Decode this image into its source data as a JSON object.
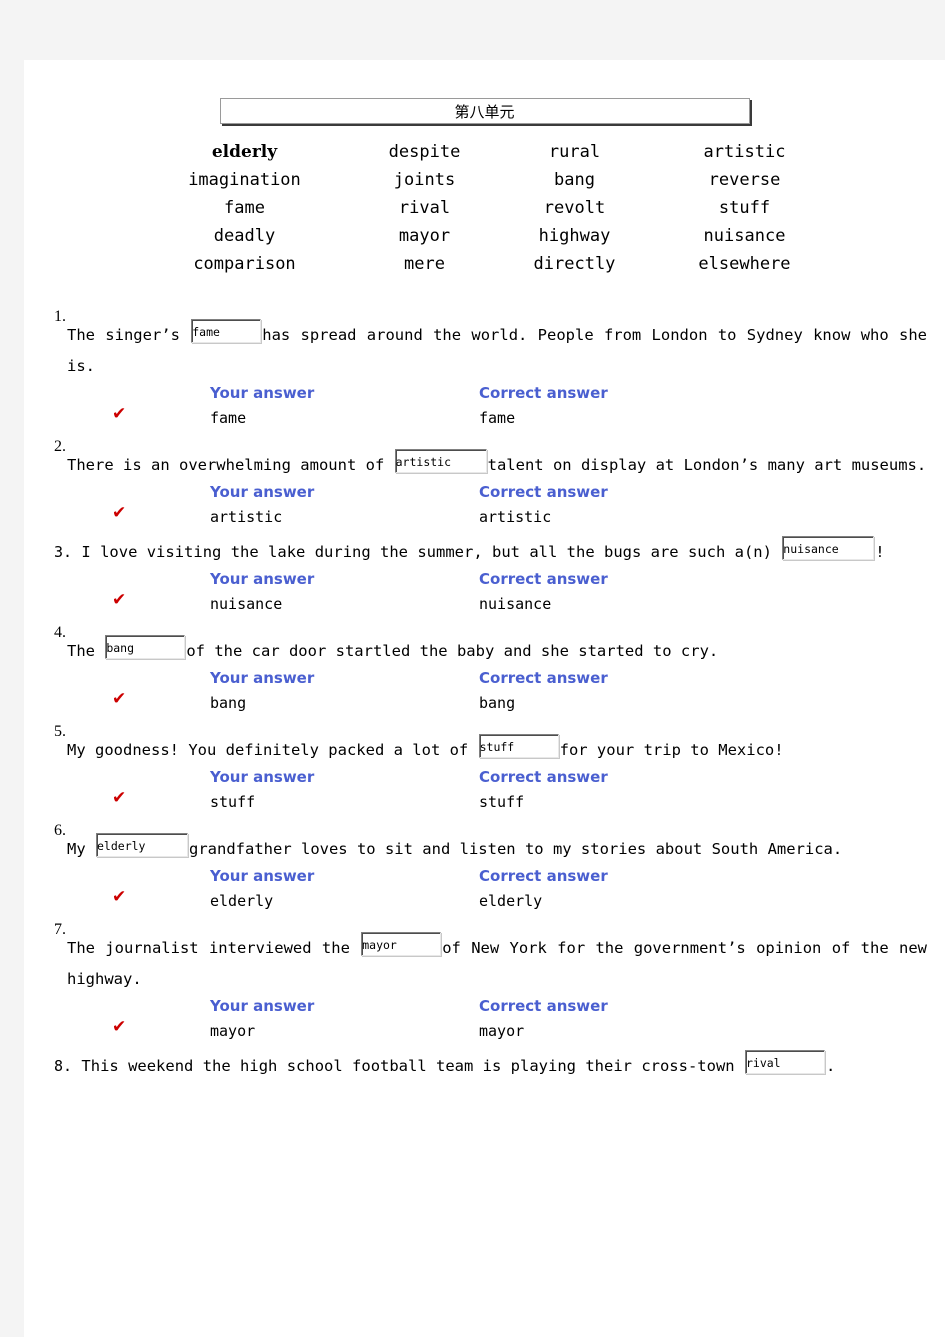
{
  "document": {
    "title": "第八单元",
    "accent_blue": "#4a5fd0",
    "check_red": "#cc0000",
    "check_glyph": "✔"
  },
  "word_bank": {
    "rows": [
      [
        {
          "word": "elderly",
          "bold": true
        },
        {
          "word": "despite",
          "bold": false
        },
        {
          "word": "rural",
          "bold": false
        },
        {
          "word": "artistic",
          "bold": false
        }
      ],
      [
        {
          "word": "imagination",
          "bold": false
        },
        {
          "word": "joints",
          "bold": false
        },
        {
          "word": "bang",
          "bold": false
        },
        {
          "word": "reverse",
          "bold": false
        }
      ],
      [
        {
          "word": "fame",
          "bold": false
        },
        {
          "word": "rival",
          "bold": false
        },
        {
          "word": "revolt",
          "bold": false
        },
        {
          "word": "stuff",
          "bold": false
        }
      ],
      [
        {
          "word": "deadly",
          "bold": false
        },
        {
          "word": "mayor",
          "bold": false
        },
        {
          "word": "highway",
          "bold": false
        },
        {
          "word": "nuisance",
          "bold": false
        }
      ],
      [
        {
          "word": "comparison",
          "bold": false
        },
        {
          "word": "mere",
          "bold": false
        },
        {
          "word": "directly",
          "bold": false
        },
        {
          "word": "elsewhere",
          "bold": false
        }
      ]
    ]
  },
  "answer_labels": {
    "your_answer": "Your answer",
    "correct_answer": "Correct answer"
  },
  "questions": [
    {
      "number": "1.",
      "layout": "number-above",
      "before": "The singer’s ",
      "blank_value": "fame",
      "blank_width": "w-sm",
      "after": "has spread around the world. People from London to Sydney know who she is.",
      "your_answer": "fame",
      "correct_answer": "fame",
      "is_correct": true
    },
    {
      "number": "2.",
      "layout": "number-above",
      "before": "There is an overwhelming amount of ",
      "blank_value": "artistic",
      "blank_width": "w-lg",
      "after": "talent on display at London’s many art museums.",
      "your_answer": "artistic",
      "correct_answer": "artistic",
      "is_correct": true
    },
    {
      "number": "3.",
      "layout": "number-inline",
      "before": "I love visiting the lake during the summer, but all the bugs are such a(n) ",
      "blank_value": "nuisance",
      "blank_width": "w-lg",
      "after": "!",
      "your_answer": "nuisance",
      "correct_answer": "nuisance",
      "is_correct": true
    },
    {
      "number": "4.",
      "layout": "number-above",
      "before": "The ",
      "blank_value": "bang",
      "blank_width": "w-md",
      "after": "of the car door startled the baby and she started to cry.",
      "your_answer": "bang",
      "correct_answer": "bang",
      "is_correct": true
    },
    {
      "number": "5.",
      "layout": "number-above",
      "before": "My goodness! You definitely packed a lot of ",
      "blank_value": "stuff",
      "blank_width": "w-md",
      "after": "for your trip to Mexico!",
      "your_answer": "stuff",
      "correct_answer": "stuff",
      "is_correct": true
    },
    {
      "number": "6.",
      "layout": "number-above",
      "before": "My ",
      "blank_value": "elderly",
      "blank_width": "w-lg",
      "after": "grandfather loves to sit and listen to my stories about South America.",
      "your_answer": "elderly",
      "correct_answer": "elderly",
      "is_correct": true
    },
    {
      "number": "7.",
      "layout": "number-above",
      "before": "The journalist interviewed the ",
      "blank_value": "mayor",
      "blank_width": "w-md",
      "after": "of New York for the government’s opinion of the new highway.",
      "your_answer": "mayor",
      "correct_answer": "mayor",
      "is_correct": true
    },
    {
      "number": "8.",
      "layout": "number-inline",
      "before": "This weekend the high school football team is playing their cross-town ",
      "blank_value": "rival",
      "blank_width": "w-md",
      "after": ".",
      "your_answer": null,
      "correct_answer": null,
      "is_correct": false
    }
  ]
}
